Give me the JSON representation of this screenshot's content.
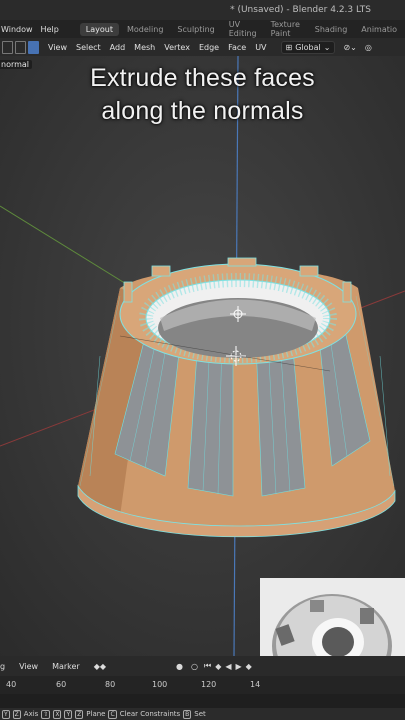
{
  "title": "* (Unsaved) - Blender 4.2.3 LTS",
  "menu": {
    "window": "Window",
    "help": "Help"
  },
  "workspaces": [
    "Layout",
    "Modeling",
    "Sculpting",
    "UV Editing",
    "Texture Paint",
    "Shading",
    "Animatio"
  ],
  "active_workspace": "Layout",
  "header_menus": [
    "View",
    "Select",
    "Add",
    "Mesh",
    "Vertex",
    "Edge",
    "Face",
    "UV"
  ],
  "orientation": "Global",
  "operator_tag": "normal",
  "caption": {
    "line1": "Extrude these faces",
    "line2": "along the normals"
  },
  "timeline": {
    "view": "View",
    "marker": "Marker",
    "frames": [
      "40",
      "60",
      "80",
      "100",
      "120",
      "14"
    ]
  },
  "status": {
    "y": "Y",
    "z": "Z",
    "axis": "Axis",
    "x2": "X",
    "y2": "Y",
    "z2": "Z",
    "plane": "Plane",
    "c": "C",
    "clear": "Clear Constraints",
    "b": "B",
    "set": "Set"
  },
  "colors": {
    "face_selected": "#e3a472",
    "edge_selected": "#6fdfe0",
    "accent": "#4772b3"
  }
}
